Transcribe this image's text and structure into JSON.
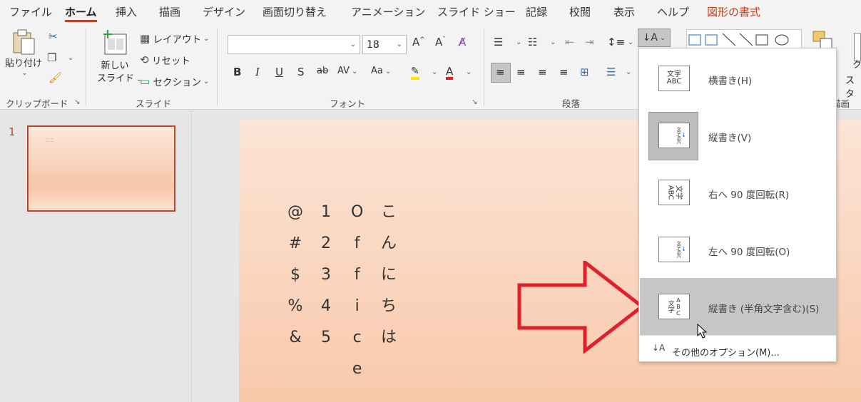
{
  "tabs": [
    "ファイル",
    "ホーム",
    "挿入",
    "描画",
    "デザイン",
    "画面切り替え",
    "アニメーション",
    "スライド ショー",
    "記録",
    "校閲",
    "表示",
    "ヘルプ",
    "図形の書式"
  ],
  "clipboard": {
    "paste": "貼り付け",
    "group": "クリップボード"
  },
  "slides_group": {
    "new_slide_line1": "新しい",
    "new_slide_line2": "スライド",
    "layout": "レイアウト",
    "reset": "リセット",
    "section": "セクション",
    "group": "スライド"
  },
  "font_group": {
    "font_name": "",
    "font_size": "18",
    "group": "フォント"
  },
  "paragraph_group": {
    "group": "段落"
  },
  "drawing_group": {
    "label_fragment": "描画",
    "ribbon_right_1": "ク",
    "ribbon_right_2": "スタ"
  },
  "thumbnail": {
    "number": "1"
  },
  "slide_text": {
    "col1": [
      "@",
      "#",
      "$",
      "%",
      "&"
    ],
    "col2": [
      "1",
      "2",
      "3",
      "4",
      "5"
    ],
    "col3": [
      "O",
      "f",
      "f",
      "i",
      "c",
      "e"
    ],
    "col4": [
      "こ",
      "ん",
      "に",
      "ち",
      "は"
    ]
  },
  "menu": {
    "items": [
      {
        "label": "横書き(H)",
        "icon": "文字\nABC"
      },
      {
        "label": "縦書き(V)",
        "icon": "文字 ABC"
      },
      {
        "label": "右へ 90 度回転(R)",
        "icon": "文字 ABC"
      },
      {
        "label": "左へ 90 度回転(O)",
        "icon": "文字 ABC"
      },
      {
        "label": "縦書き (半角文字含む)(S)",
        "icon": "文字 ABC"
      }
    ],
    "more": "その他のオプション(M)..."
  },
  "colors": {
    "accent": "#b7472a",
    "arrow": "#e0202a",
    "selected": "#c6c6c6"
  }
}
